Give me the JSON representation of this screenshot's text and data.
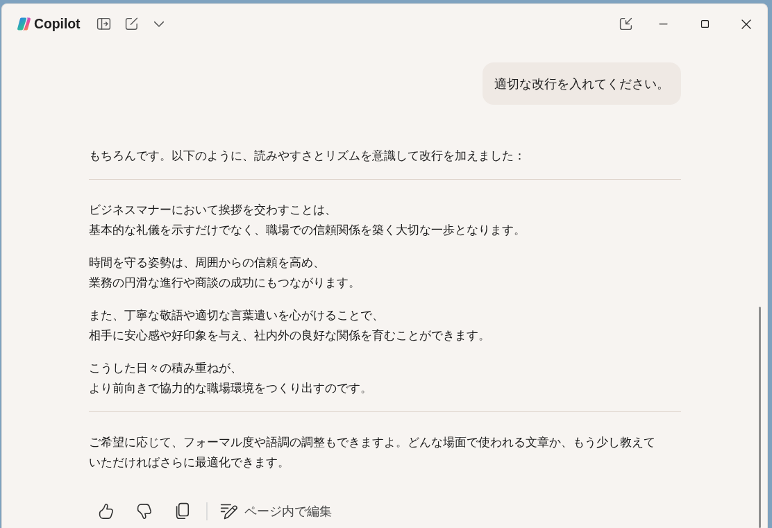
{
  "app": {
    "title": "Copilot"
  },
  "user_message": {
    "text": "適切な改行を入れてください。"
  },
  "response": {
    "blocks": [
      {
        "kind": "paragraph",
        "lines": [
          "もちろんです。以下のように、読みやすさとリズムを意識して改行を加えました："
        ]
      },
      {
        "kind": "rule"
      },
      {
        "kind": "paragraph",
        "lines": [
          "ビジネスマナーにおいて挨拶を交わすことは、",
          "基本的な礼儀を示すだけでなく、職場での信頼関係を築く大切な一歩となります。"
        ]
      },
      {
        "kind": "paragraph",
        "lines": [
          "時間を守る姿勢は、周囲からの信頼を高め、",
          "業務の円滑な進行や商談の成功にもつながります。"
        ]
      },
      {
        "kind": "paragraph",
        "lines": [
          "また、丁寧な敬語や適切な言葉遣いを心がけることで、",
          "相手に安心感や好印象を与え、社内外の良好な関係を育むことができます。"
        ]
      },
      {
        "kind": "paragraph",
        "lines": [
          "こうした日々の積み重ねが、",
          "より前向きで協力的な職場環境をつくり出すのです。"
        ]
      },
      {
        "kind": "rule"
      },
      {
        "kind": "paragraph",
        "lines": [
          "ご希望に応じて、フォーマル度や語調の調整もできますよ。どんな場面で使われる文章か、もう少し教えて",
          "いただければさらに最適化できます。"
        ]
      }
    ]
  },
  "actions": {
    "edit_label": "ページ内で編集"
  }
}
